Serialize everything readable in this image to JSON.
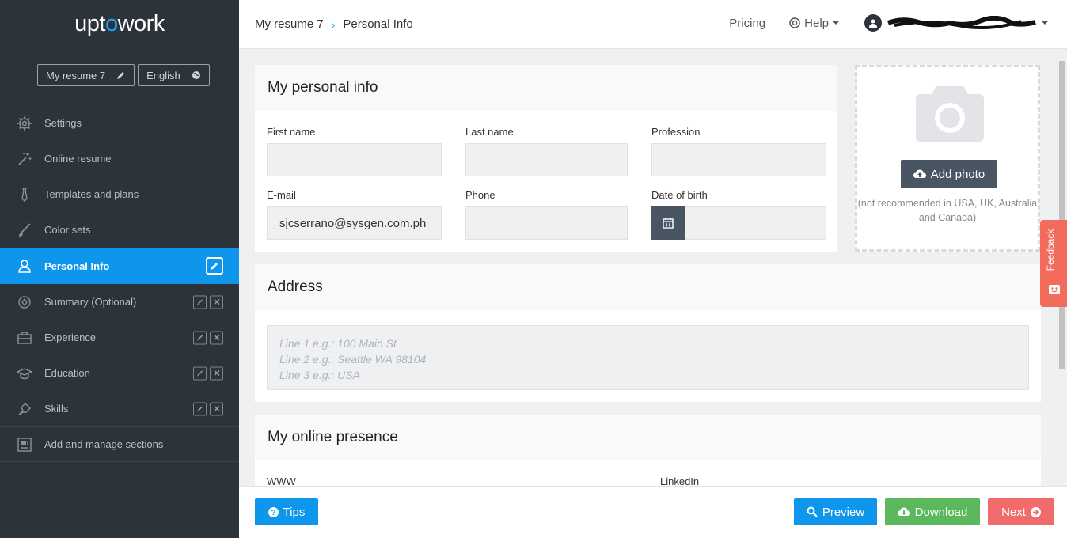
{
  "sidebar": {
    "logo_pre": "upt",
    "logo_o": "o",
    "logo_post": "work",
    "resume_btn": "My resume 7",
    "lang_btn": "English",
    "items": [
      {
        "label": "Settings"
      },
      {
        "label": "Online resume"
      },
      {
        "label": "Templates and plans"
      },
      {
        "label": "Color sets"
      },
      {
        "label": "Personal Info"
      },
      {
        "label": "Summary (Optional)"
      },
      {
        "label": "Experience"
      },
      {
        "label": "Education"
      },
      {
        "label": "Skills"
      },
      {
        "label": "Add and manage sections"
      }
    ]
  },
  "topbar": {
    "breadcrumb": [
      "My resume 7",
      "Personal Info"
    ],
    "pricing": "Pricing",
    "help": "Help"
  },
  "personal": {
    "title": "My personal info",
    "first_name_label": "First name",
    "last_name_label": "Last name",
    "profession_label": "Profession",
    "email_label": "E-mail",
    "email_value": "sjcserrano@sysgen.com.ph",
    "phone_label": "Phone",
    "dob_label": "Date of birth"
  },
  "photo": {
    "add_label": "Add photo",
    "note": "(not recommended in USA, UK, Australia and Canada)"
  },
  "address": {
    "title": "Address",
    "line1": "Line 1 e.g.: 100 Main St",
    "line2": "Line 2 e.g.: Seattle WA 98104",
    "line3": "Line 3 e.g.: USA"
  },
  "online": {
    "title": "My online presence",
    "www_label": "WWW",
    "linkedin_label": "LinkedIn"
  },
  "feedback": "Feedback",
  "bottom": {
    "tips": "Tips",
    "preview": "Preview",
    "download": "Download",
    "next": "Next"
  },
  "colors": {
    "sidebar_bg": "#2d333b",
    "accent": "#0d96ec",
    "download": "#5cb85c",
    "next": "#f26b6b",
    "feedback": "#f26b5b"
  }
}
